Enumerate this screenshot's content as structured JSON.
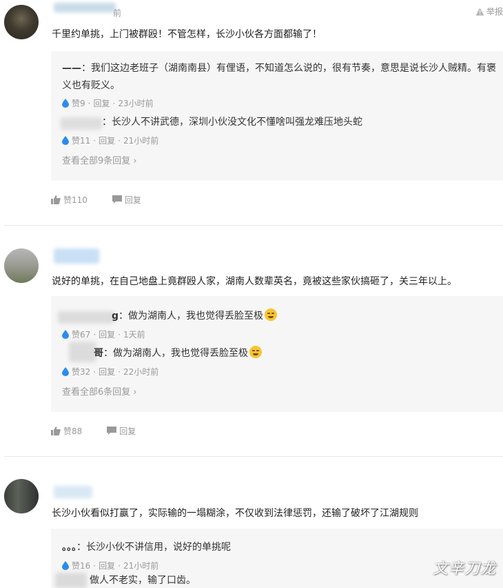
{
  "report_label": "举报",
  "comments": [
    {
      "time": "前",
      "text": "千里约单挑，上门被群殴！不管怎样，长沙小伙各方面都输了！",
      "replies": [
        {
          "who": "——",
          "text": "：我们这边老班子（湖南南县）有俚语，不知道怎么说的，很有节奏，意思是说长沙人贼精。有褒",
          "text2": "义也有贬义。",
          "likes": "赞9",
          "reply": "回复",
          "time": "23小时前"
        },
        {
          "who": "",
          "text": "：长沙人不讲武德，深圳小伙没文化不懂啥叫强龙难压地头蛇",
          "likes": "赞11",
          "reply": "回复",
          "time": "21小时前"
        }
      ],
      "view_all": "查看全部9条回复",
      "likes": "赞110",
      "reply_action": "回复"
    },
    {
      "text": "说好的单挑，在自己地盘上竟群殴人家，湖南人数辈英名，竟被这些家伙搞砸了，关三年以上。",
      "replies": [
        {
          "who": "g",
          "text": "：做为湖南人，我也觉得丢脸至极",
          "likes": "赞67",
          "reply": "回复",
          "time": "1天前"
        },
        {
          "who": "哥",
          "text": "：做为湖南人，我也觉得丢脸至极",
          "likes": "赞32",
          "reply": "回复",
          "time": "22小时前"
        }
      ],
      "view_all": "查看全部6条回复",
      "likes": "赞88",
      "reply_action": "回复"
    },
    {
      "text": "长沙小伙看似打赢了，实际输的一塌糊涂，不仅收到法律惩罚，还输了破坏了江湖规则",
      "replies": [
        {
          "who": "。。。",
          "text": "：长沙小伙不讲信用，说好的单挑呢",
          "likes": "赞16",
          "reply": "回复",
          "time": "21小时前"
        },
        {
          "who": "",
          "text": "做人不老实，输了口齿。"
        }
      ]
    }
  ],
  "watermark": "文辛刀龙",
  "colors": {
    "meta": "#999999",
    "reply_bg": "#f6f6f6",
    "drop": "#2a8cf0"
  }
}
